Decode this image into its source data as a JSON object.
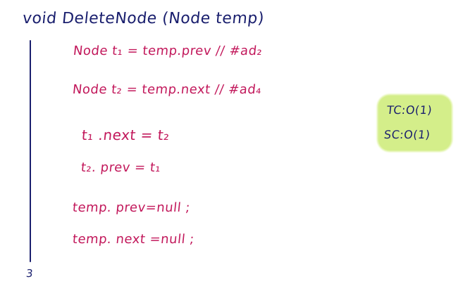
{
  "note": {
    "title": "void DeleteNode (Node temp)",
    "lines": [
      "Node t₁ = temp.prev   //  #ad₂",
      "Node t₂ = temp.next     // #ad₄",
      "t₁ .next = t₂",
      "t₂.  prev  =  t₁",
      "temp. prev=null ;",
      "temp.  next =null ;"
    ],
    "closing_brace": "3",
    "complexity": {
      "time": "TC:O(1)",
      "space": "SC:O(1)"
    }
  },
  "colors": {
    "background": "#ffffff",
    "header_ink": "#1a1f6e",
    "body_ink": "#c2185b",
    "highlight": "#d4ee8a"
  }
}
